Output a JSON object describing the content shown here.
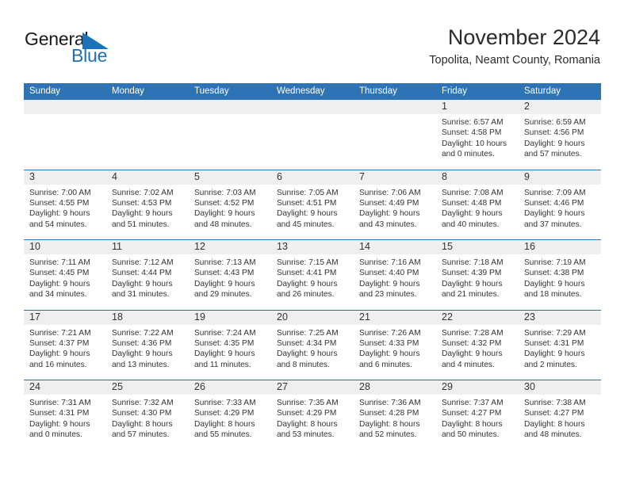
{
  "brand": {
    "text_general": "General",
    "text_blue": "Blue",
    "logo_icon": "triangle-icon",
    "accent_color": "#1d71b8"
  },
  "header": {
    "title": "November 2024",
    "subtitle": "Topolita, Neamt County, Romania"
  },
  "calendar": {
    "header_color": "#2e74b5",
    "weekdays": [
      "Sunday",
      "Monday",
      "Tuesday",
      "Wednesday",
      "Thursday",
      "Friday",
      "Saturday"
    ],
    "weeks": [
      [
        {
          "day": "",
          "sunrise": "",
          "sunset": "",
          "daylight": "",
          "empty": true
        },
        {
          "day": "",
          "sunrise": "",
          "sunset": "",
          "daylight": "",
          "empty": true
        },
        {
          "day": "",
          "sunrise": "",
          "sunset": "",
          "daylight": "",
          "empty": true
        },
        {
          "day": "",
          "sunrise": "",
          "sunset": "",
          "daylight": "",
          "empty": true
        },
        {
          "day": "",
          "sunrise": "",
          "sunset": "",
          "daylight": "",
          "empty": true
        },
        {
          "day": "1",
          "sunrise": "Sunrise: 6:57 AM",
          "sunset": "Sunset: 4:58 PM",
          "daylight": "Daylight: 10 hours and 0 minutes.",
          "empty": false
        },
        {
          "day": "2",
          "sunrise": "Sunrise: 6:59 AM",
          "sunset": "Sunset: 4:56 PM",
          "daylight": "Daylight: 9 hours and 57 minutes.",
          "empty": false
        }
      ],
      [
        {
          "day": "3",
          "sunrise": "Sunrise: 7:00 AM",
          "sunset": "Sunset: 4:55 PM",
          "daylight": "Daylight: 9 hours and 54 minutes.",
          "empty": false
        },
        {
          "day": "4",
          "sunrise": "Sunrise: 7:02 AM",
          "sunset": "Sunset: 4:53 PM",
          "daylight": "Daylight: 9 hours and 51 minutes.",
          "empty": false
        },
        {
          "day": "5",
          "sunrise": "Sunrise: 7:03 AM",
          "sunset": "Sunset: 4:52 PM",
          "daylight": "Daylight: 9 hours and 48 minutes.",
          "empty": false
        },
        {
          "day": "6",
          "sunrise": "Sunrise: 7:05 AM",
          "sunset": "Sunset: 4:51 PM",
          "daylight": "Daylight: 9 hours and 45 minutes.",
          "empty": false
        },
        {
          "day": "7",
          "sunrise": "Sunrise: 7:06 AM",
          "sunset": "Sunset: 4:49 PM",
          "daylight": "Daylight: 9 hours and 43 minutes.",
          "empty": false
        },
        {
          "day": "8",
          "sunrise": "Sunrise: 7:08 AM",
          "sunset": "Sunset: 4:48 PM",
          "daylight": "Daylight: 9 hours and 40 minutes.",
          "empty": false
        },
        {
          "day": "9",
          "sunrise": "Sunrise: 7:09 AM",
          "sunset": "Sunset: 4:46 PM",
          "daylight": "Daylight: 9 hours and 37 minutes.",
          "empty": false
        }
      ],
      [
        {
          "day": "10",
          "sunrise": "Sunrise: 7:11 AM",
          "sunset": "Sunset: 4:45 PM",
          "daylight": "Daylight: 9 hours and 34 minutes.",
          "empty": false
        },
        {
          "day": "11",
          "sunrise": "Sunrise: 7:12 AM",
          "sunset": "Sunset: 4:44 PM",
          "daylight": "Daylight: 9 hours and 31 minutes.",
          "empty": false
        },
        {
          "day": "12",
          "sunrise": "Sunrise: 7:13 AM",
          "sunset": "Sunset: 4:43 PM",
          "daylight": "Daylight: 9 hours and 29 minutes.",
          "empty": false
        },
        {
          "day": "13",
          "sunrise": "Sunrise: 7:15 AM",
          "sunset": "Sunset: 4:41 PM",
          "daylight": "Daylight: 9 hours and 26 minutes.",
          "empty": false
        },
        {
          "day": "14",
          "sunrise": "Sunrise: 7:16 AM",
          "sunset": "Sunset: 4:40 PM",
          "daylight": "Daylight: 9 hours and 23 minutes.",
          "empty": false
        },
        {
          "day": "15",
          "sunrise": "Sunrise: 7:18 AM",
          "sunset": "Sunset: 4:39 PM",
          "daylight": "Daylight: 9 hours and 21 minutes.",
          "empty": false
        },
        {
          "day": "16",
          "sunrise": "Sunrise: 7:19 AM",
          "sunset": "Sunset: 4:38 PM",
          "daylight": "Daylight: 9 hours and 18 minutes.",
          "empty": false
        }
      ],
      [
        {
          "day": "17",
          "sunrise": "Sunrise: 7:21 AM",
          "sunset": "Sunset: 4:37 PM",
          "daylight": "Daylight: 9 hours and 16 minutes.",
          "empty": false
        },
        {
          "day": "18",
          "sunrise": "Sunrise: 7:22 AM",
          "sunset": "Sunset: 4:36 PM",
          "daylight": "Daylight: 9 hours and 13 minutes.",
          "empty": false
        },
        {
          "day": "19",
          "sunrise": "Sunrise: 7:24 AM",
          "sunset": "Sunset: 4:35 PM",
          "daylight": "Daylight: 9 hours and 11 minutes.",
          "empty": false
        },
        {
          "day": "20",
          "sunrise": "Sunrise: 7:25 AM",
          "sunset": "Sunset: 4:34 PM",
          "daylight": "Daylight: 9 hours and 8 minutes.",
          "empty": false
        },
        {
          "day": "21",
          "sunrise": "Sunrise: 7:26 AM",
          "sunset": "Sunset: 4:33 PM",
          "daylight": "Daylight: 9 hours and 6 minutes.",
          "empty": false
        },
        {
          "day": "22",
          "sunrise": "Sunrise: 7:28 AM",
          "sunset": "Sunset: 4:32 PM",
          "daylight": "Daylight: 9 hours and 4 minutes.",
          "empty": false
        },
        {
          "day": "23",
          "sunrise": "Sunrise: 7:29 AM",
          "sunset": "Sunset: 4:31 PM",
          "daylight": "Daylight: 9 hours and 2 minutes.",
          "empty": false
        }
      ],
      [
        {
          "day": "24",
          "sunrise": "Sunrise: 7:31 AM",
          "sunset": "Sunset: 4:31 PM",
          "daylight": "Daylight: 9 hours and 0 minutes.",
          "empty": false
        },
        {
          "day": "25",
          "sunrise": "Sunrise: 7:32 AM",
          "sunset": "Sunset: 4:30 PM",
          "daylight": "Daylight: 8 hours and 57 minutes.",
          "empty": false
        },
        {
          "day": "26",
          "sunrise": "Sunrise: 7:33 AM",
          "sunset": "Sunset: 4:29 PM",
          "daylight": "Daylight: 8 hours and 55 minutes.",
          "empty": false
        },
        {
          "day": "27",
          "sunrise": "Sunrise: 7:35 AM",
          "sunset": "Sunset: 4:29 PM",
          "daylight": "Daylight: 8 hours and 53 minutes.",
          "empty": false
        },
        {
          "day": "28",
          "sunrise": "Sunrise: 7:36 AM",
          "sunset": "Sunset: 4:28 PM",
          "daylight": "Daylight: 8 hours and 52 minutes.",
          "empty": false
        },
        {
          "day": "29",
          "sunrise": "Sunrise: 7:37 AM",
          "sunset": "Sunset: 4:27 PM",
          "daylight": "Daylight: 8 hours and 50 minutes.",
          "empty": false
        },
        {
          "day": "30",
          "sunrise": "Sunrise: 7:38 AM",
          "sunset": "Sunset: 4:27 PM",
          "daylight": "Daylight: 8 hours and 48 minutes.",
          "empty": false
        }
      ]
    ]
  }
}
